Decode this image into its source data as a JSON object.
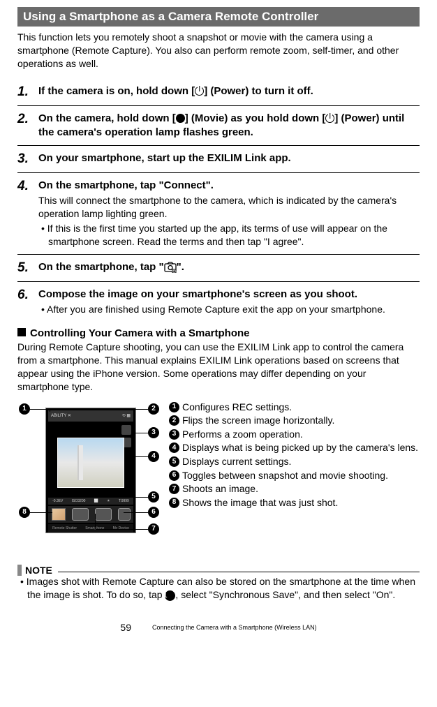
{
  "header": "Using a Smartphone as a Camera Remote Controller",
  "intro": "This function lets you remotely shoot a snapshot or movie with the camera using a smartphone (Remote Capture). You also can perform remote zoom, self-timer, and other operations as well.",
  "steps": [
    {
      "num": "1.",
      "title_pre": "If the camera is on, hold down [",
      "title_post": "] (Power) to turn it off."
    },
    {
      "num": "2.",
      "title_pre": "On the camera, hold down [",
      "title_mid": "] (Movie) as you hold down [",
      "title_post": "] (Power) until the camera's operation lamp flashes green."
    },
    {
      "num": "3.",
      "title": "On your smartphone, start up the EXILIM Link app."
    },
    {
      "num": "4.",
      "title": "On the smartphone, tap \"Connect\".",
      "desc": "This will connect the smartphone to the camera, which is indicated by the camera's operation lamp lighting green.",
      "bullet": "If this is the first time you started up the app, its terms of use will appear on the smartphone screen. Read the terms and then tap \"I agree\"."
    },
    {
      "num": "5.",
      "title_pre": "On the smartphone, tap \"",
      "title_post": "\"."
    },
    {
      "num": "6.",
      "title": "Compose the image on your smartphone's screen as you shoot.",
      "bullet": "After you are finished using Remote Capture exit the app on your smartphone."
    }
  ],
  "subsection": {
    "title": "Controlling Your Camera with a Smartphone",
    "desc": "During Remote Capture shooting, you can use the EXILIM Link app to control the camera from a smartphone. This manual explains EXILIM Link operations based on screens that appear using the iPhone version. Some operations may differ depending on your smartphone type."
  },
  "callouts": [
    "1",
    "2",
    "3",
    "4",
    "5",
    "6",
    "7",
    "8"
  ],
  "legend": [
    "Configures REC settings.",
    "Flips the screen image horizontally.",
    "Performs a zoom operation.",
    "Displays what is being picked up by the camera's lens.",
    "Displays current settings.",
    "Toggles between snapshot and movie shooting.",
    "Shoots an image.",
    "Shows the image that was just shot."
  ],
  "note": {
    "label": "NOTE",
    "text_pre": "Images shot with Remote Capture can also be stored on the smartphone at the time when the image is shot. To do so, tap ",
    "text_post": ", select \"Synchronous Save\", and then select \"On\"."
  },
  "footer": {
    "page": "59",
    "chapter": "Connecting the Camera with a Smartphone (Wireless LAN)"
  }
}
